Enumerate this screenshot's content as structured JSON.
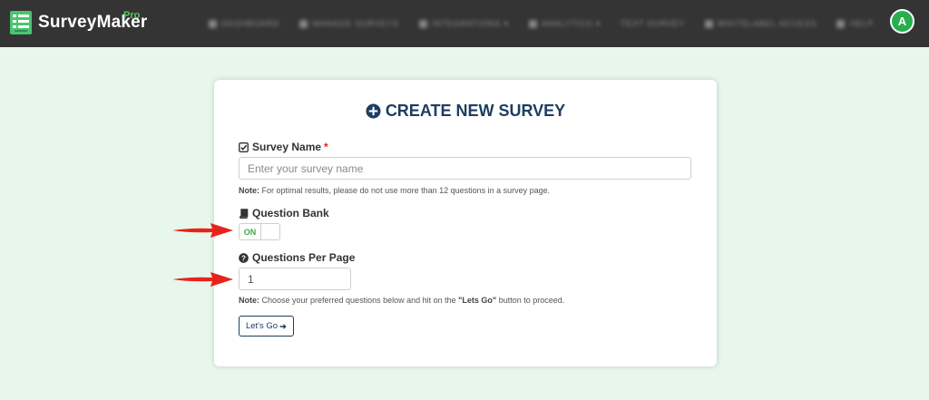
{
  "header": {
    "brand_name": "SurveyMaker",
    "brand_badge": "Pro",
    "nav_items": [
      "DASHBOARD",
      "MANAGE SURVEYS",
      "INTEGRATIONS ▾",
      "ANALYTICS ▾",
      "TEXT SURVEY",
      "WHITELABEL ACCESS",
      "HELP"
    ],
    "avatar_initial": "A",
    "avatar_color": "#27ae4f",
    "bar_color": "#343434"
  },
  "card": {
    "title": "CREATE NEW SURVEY",
    "survey_name": {
      "label": "Survey Name",
      "required_mark": "*",
      "placeholder": "Enter your survey name",
      "value": ""
    },
    "note1": {
      "prefix": "Note:",
      "text": " For optimal results, please do not use more than 12 questions in a survey page."
    },
    "question_bank": {
      "label": "Question Bank",
      "toggle_label": "ON"
    },
    "questions_per_page": {
      "label": "Questions Per Page",
      "value": "1"
    },
    "note2": {
      "prefix": "Note:",
      "text_before": " Choose your preferred questions below and hit on the ",
      "emphasis": "\"Lets Go\"",
      "text_after": " button to proceed."
    },
    "submit_label": "Let's Go"
  },
  "colors": {
    "page_bg": "#e8f7ec",
    "title": "#1d3d63",
    "accent_green": "#3aa845",
    "annotation_arrow": "#e8231c"
  }
}
